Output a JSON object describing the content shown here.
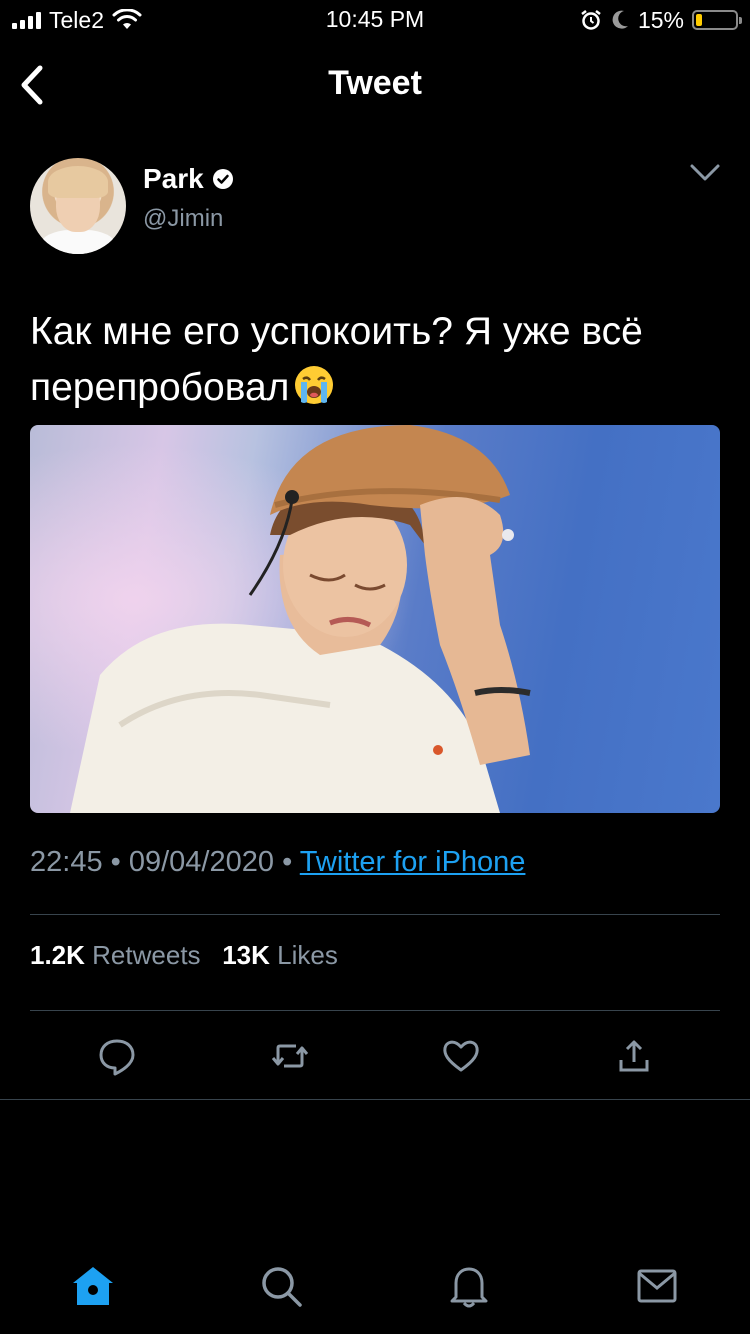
{
  "status_bar": {
    "carrier": "Tele2",
    "time": "10:45 PM",
    "battery_percent": "15%",
    "battery_level": 0.15,
    "icons": [
      "signal-icon",
      "wifi-icon",
      "alarm-icon",
      "moon-icon",
      "battery-icon"
    ]
  },
  "nav": {
    "title": "Tweet",
    "back_icon": "chevron-left-icon"
  },
  "tweet": {
    "author_name": "Park",
    "verified": true,
    "handle": "@Jimin",
    "text": "Как мне его успокоить? Я уже всё перепробовал",
    "emoji": "loudly-crying-face-emoji",
    "time": "22:45",
    "date": "09/04/2020",
    "separator": "•",
    "source": "Twitter for iPhone",
    "retweets_count": "1.2K",
    "retweets_label": "Retweets",
    "likes_count": "13K",
    "likes_label": "Likes"
  },
  "actions": [
    "reply-icon",
    "retweet-icon",
    "like-icon",
    "share-icon"
  ],
  "tabbar": [
    "home-icon",
    "search-icon",
    "notifications-icon",
    "messages-icon"
  ],
  "colors": {
    "background": "#000000",
    "text": "#ffffff",
    "secondary": "#8b98a5",
    "accent": "#1da1f2",
    "divider": "#38444d",
    "battery": "#ffcc00"
  }
}
